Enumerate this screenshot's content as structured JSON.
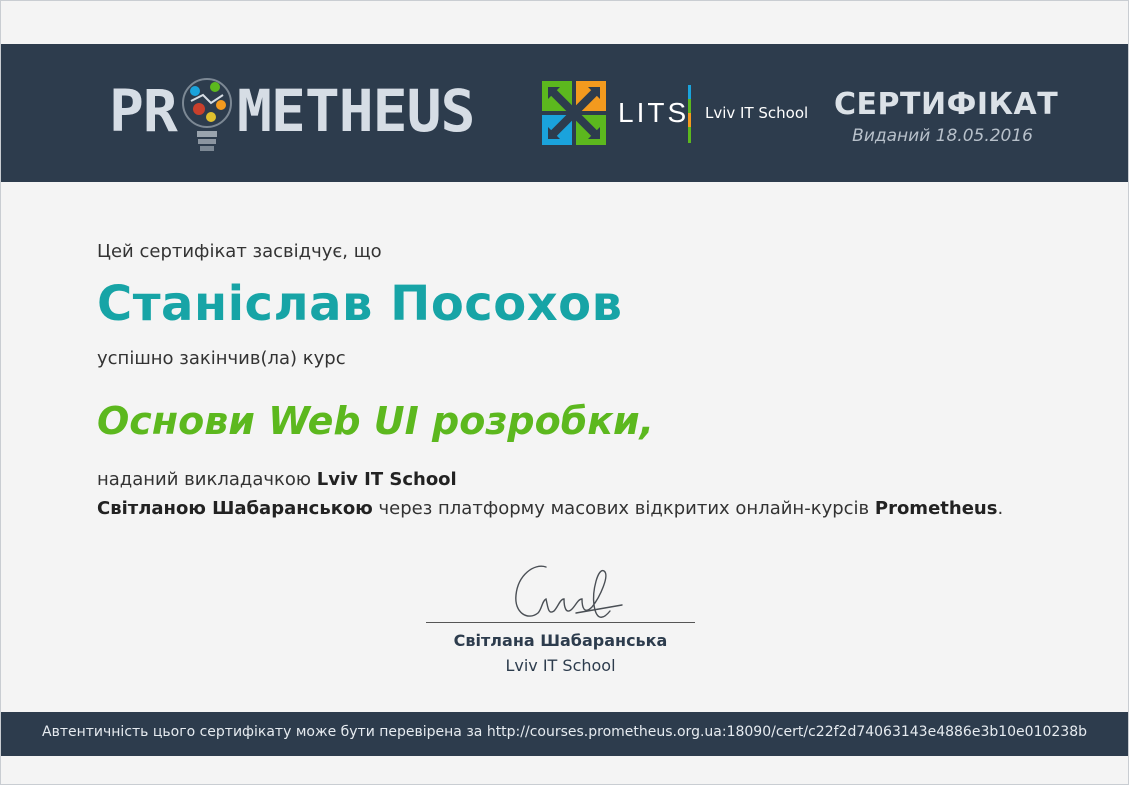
{
  "header": {
    "logo_left": "PR",
    "logo_right": "METHEUS",
    "lits_label": "LITS",
    "lits_school": "Lviv IT School",
    "title": "СЕРТИФІКАТ",
    "issued": "Виданий 18.05.2016"
  },
  "body": {
    "intro": "Цей сертифікат засвідчує, що",
    "student_name": "Станіслав Посохов",
    "completed": "успішно закінчив(ла) курс",
    "course_name": "Основи Web UI розробки,",
    "line1_prefix": "наданий викладачкою ",
    "line1_org": "Lviv IT School",
    "line2_teacher": "Світланою Шабаранською",
    "line2_mid": " через платформу масових відкритих онлайн-курсів ",
    "line2_platform": "Prometheus",
    "line2_end": "."
  },
  "signature": {
    "name": "Світлана Шабаранська",
    "org": "Lviv IT School"
  },
  "footer": {
    "text": "Автентичність цього сертифікату може бути перевірена за http://courses.prometheus.org.ua:18090/cert/c22f2d74063143e4886e3b10e010238b"
  },
  "colors": {
    "header_bg": "#2d3c4d",
    "student_name": "#17a4a6",
    "course_name": "#5cb81e",
    "lits_blue": "#1aa3dc",
    "lits_orange": "#f39a1e",
    "lits_green": "#5cb81e"
  },
  "icons": {
    "bulb": "lightbulb-icon",
    "lits_mark": "lits-cross-logo"
  }
}
